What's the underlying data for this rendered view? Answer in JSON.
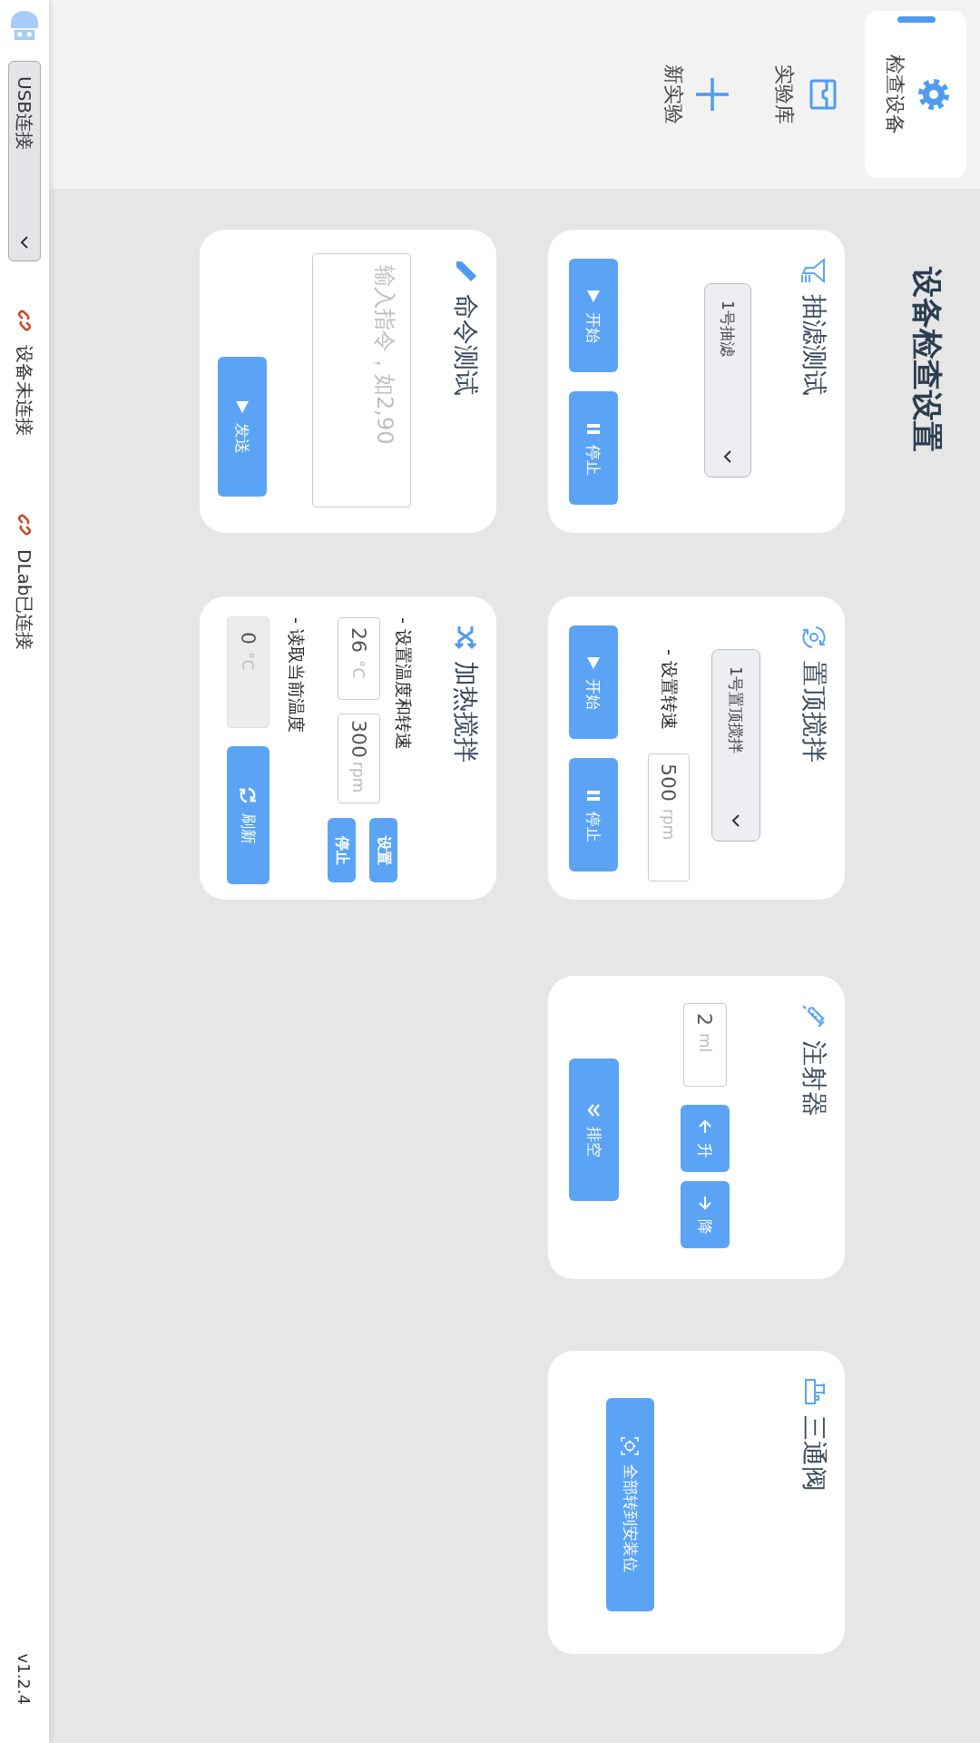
{
  "sidebar": {
    "items": [
      {
        "label": "检查设备",
        "selected": true
      },
      {
        "label": "实验库",
        "selected": false
      },
      {
        "label": "新实验",
        "selected": false
      }
    ]
  },
  "title": "设备检查设置",
  "cards": [
    {
      "kind": "filtration",
      "title": "抽滤测试",
      "select": "1号抽滤",
      "buttons": [
        "开始",
        "停止"
      ]
    },
    {
      "kind": "stirrer",
      "title": "置顶搅拌",
      "select": "1号置顶搅拌",
      "speed_label": "- 设置转速",
      "speed": {
        "value": "500",
        "unit": "rpm"
      },
      "buttons": [
        "开始",
        "停止"
      ]
    },
    {
      "kind": "syringe",
      "title": "注射器",
      "volume": {
        "value": "2",
        "unit": "ml"
      },
      "buttons": [
        "升",
        "降",
        "排空"
      ]
    },
    {
      "kind": "valve",
      "title": "三通阀",
      "buttons": [
        "全部转到安装位"
      ]
    },
    {
      "kind": "command",
      "title": "命令测试",
      "command": {
        "placeholder": "输入指令，如2,90"
      },
      "buttons": [
        "发送"
      ]
    },
    {
      "kind": "heater",
      "title": "加热搅拌",
      "set_label": "- 设置温度和转速",
      "temperature": {
        "value": "26",
        "unit": "°C"
      },
      "speed": {
        "value": "300",
        "unit": "rpm"
      },
      "buttons": [
        "设置",
        "停止"
      ],
      "read_label": "- 读取当前温度",
      "reading": {
        "value": "0",
        "unit": "°C",
        "disabled": true
      },
      "refresh": "刷新"
    }
  ],
  "status_bar": {
    "connection_select": "USB连接",
    "links": [
      {
        "label": "设备未连接"
      },
      {
        "label": "DLab已连接"
      }
    ],
    "version": "v1.2.4"
  }
}
